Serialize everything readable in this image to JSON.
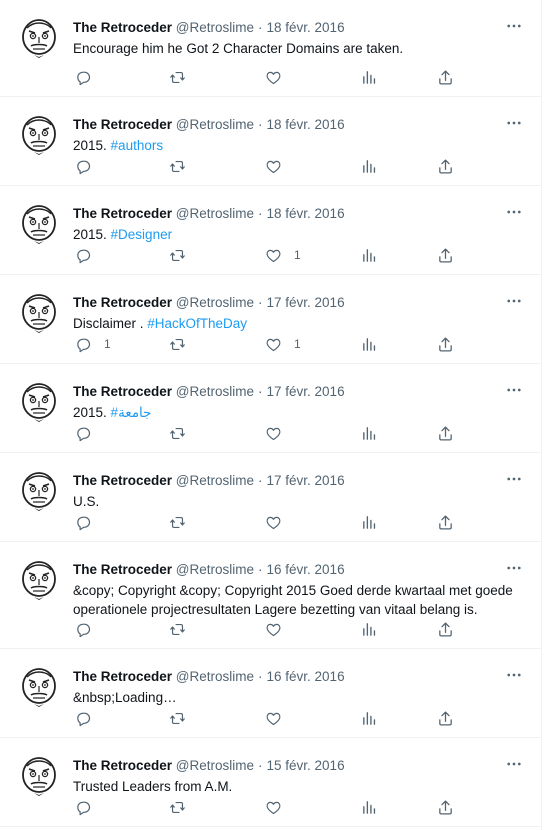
{
  "author": {
    "name": "The Retroceder",
    "handle": "@Retroslime"
  },
  "tweets": [
    {
      "date": "18 févr. 2016",
      "text": "Encourage him he Got 2 Character Domains are taken.",
      "hashtag": "",
      "replies": "",
      "likes": ""
    },
    {
      "date": "18 févr. 2016",
      "text": "2015. ",
      "hashtag": "#authors",
      "replies": "",
      "likes": ""
    },
    {
      "date": "18 févr. 2016",
      "text": "2015. ",
      "hashtag": "#Designer",
      "replies": "",
      "likes": "1"
    },
    {
      "date": "17 févr. 2016",
      "text": "Disclaimer . ",
      "hashtag": "#HackOfTheDay",
      "replies": "1",
      "likes": "1"
    },
    {
      "date": "17 févr. 2016",
      "text": "2015. ",
      "hashtag": "#جامعة",
      "replies": "",
      "likes": ""
    },
    {
      "date": "17 févr. 2016",
      "text": "U.S.",
      "hashtag": "",
      "replies": "",
      "likes": ""
    },
    {
      "date": "16 févr. 2016",
      "text": "&copy; Copyright &copy; Copyright 2015 Goed derde kwartaal met goede operationele projectresultaten Lagere bezetting van vitaal belang is.",
      "hashtag": "",
      "replies": "",
      "likes": ""
    },
    {
      "date": "16 févr. 2016",
      "text": "&nbsp;Loading…",
      "hashtag": "",
      "replies": "",
      "likes": ""
    },
    {
      "date": "15 févr. 2016",
      "text": "Trusted Leaders from A.M.",
      "hashtag": "",
      "replies": "",
      "likes": ""
    }
  ],
  "separator": "·",
  "icons": {
    "more": "more-icon",
    "reply": "reply-icon",
    "retweet": "retweet-icon",
    "like": "like-icon",
    "views": "views-icon",
    "share": "share-icon"
  },
  "colors": {
    "text": "#0f1419",
    "secondary": "#536471",
    "link": "#1d9bf0",
    "border": "#eff3f4"
  }
}
